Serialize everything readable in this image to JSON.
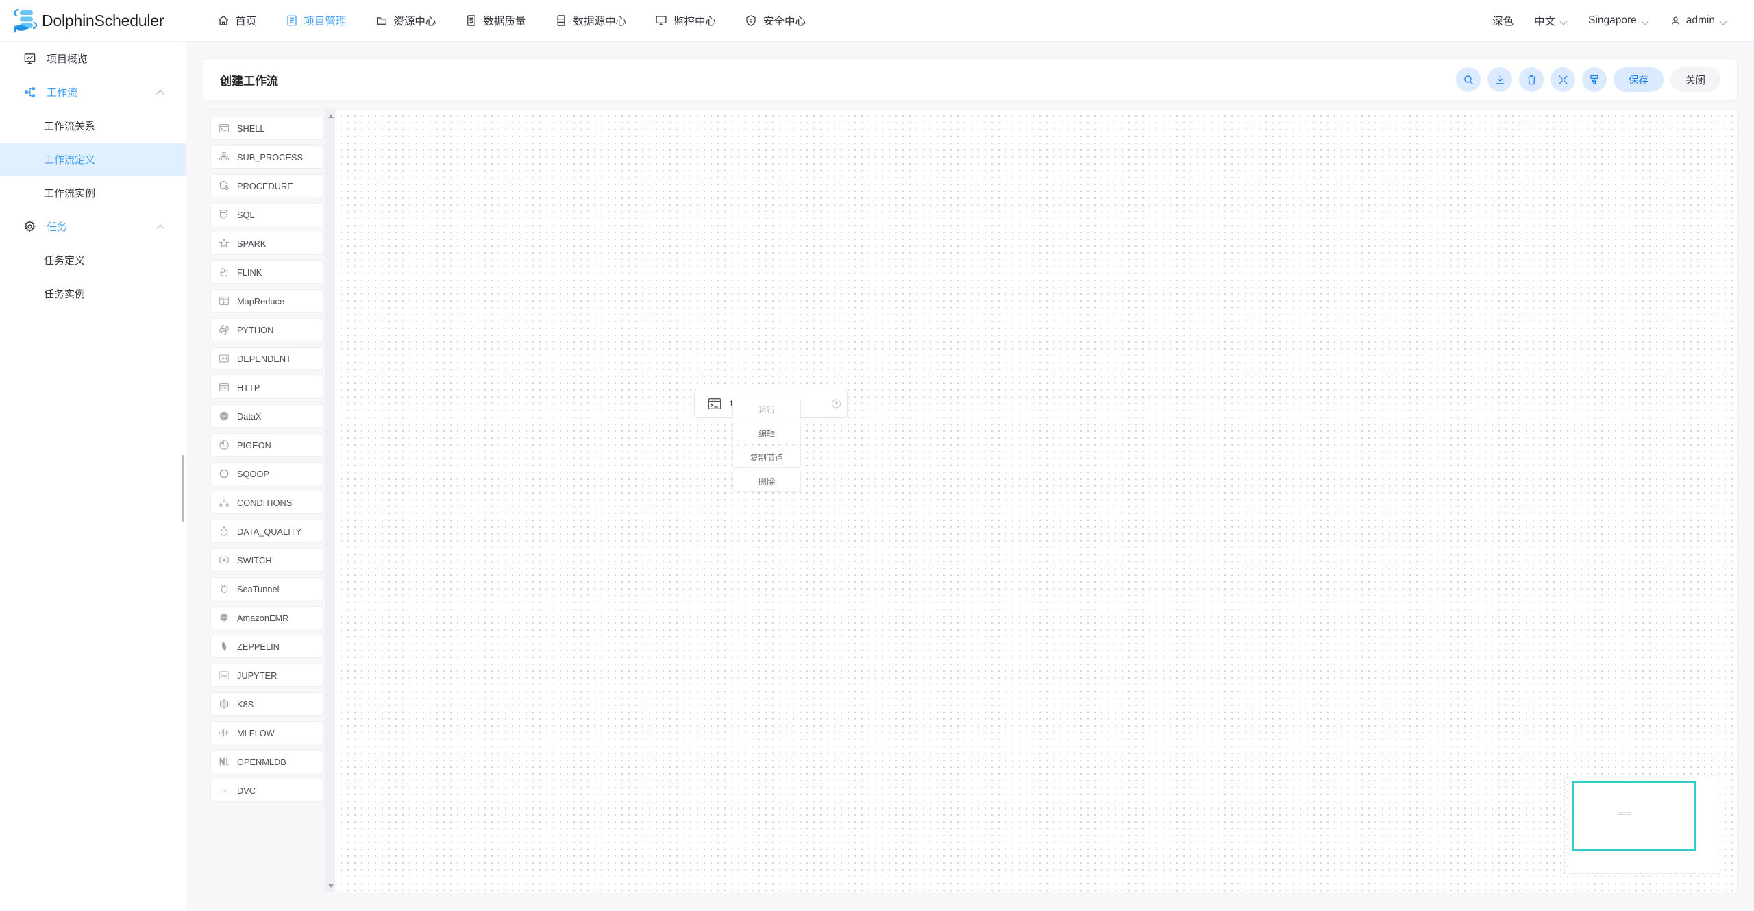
{
  "brand": {
    "name": "DolphinScheduler",
    "logo_icon": "dolphin-logo-icon"
  },
  "topnav": {
    "items": [
      {
        "label": "首页",
        "icon": "home-icon",
        "active": false
      },
      {
        "label": "项目管理",
        "icon": "project-icon",
        "active": true
      },
      {
        "label": "资源中心",
        "icon": "folder-icon",
        "active": false
      },
      {
        "label": "数据质量",
        "icon": "quality-icon",
        "active": false
      },
      {
        "label": "数据源中心",
        "icon": "datasource-icon",
        "active": false
      },
      {
        "label": "监控中心",
        "icon": "monitor-icon",
        "active": false
      },
      {
        "label": "安全中心",
        "icon": "shield-icon",
        "active": false
      }
    ],
    "right": {
      "theme": "深色",
      "language": "中文",
      "timezone": "Singapore",
      "user": "admin",
      "user_icon": "user-icon"
    }
  },
  "sidebar": {
    "items": [
      {
        "label": "项目概览",
        "icon": "overview-icon",
        "type": "link"
      },
      {
        "label": "工作流",
        "icon": "workflow-icon",
        "type": "group",
        "expanded": true
      },
      {
        "label": "工作流关系",
        "type": "sub"
      },
      {
        "label": "工作流定义",
        "type": "sub",
        "selected": true
      },
      {
        "label": "工作流实例",
        "type": "sub"
      },
      {
        "label": "任务",
        "icon": "gear-icon",
        "type": "group",
        "expanded": true
      },
      {
        "label": "任务定义",
        "type": "sub"
      },
      {
        "label": "任务实例",
        "type": "sub"
      }
    ]
  },
  "page": {
    "title": "创建工作流",
    "toolbar": {
      "icons": [
        {
          "name": "search-icon",
          "label": "搜索"
        },
        {
          "name": "download-icon",
          "label": "下载"
        },
        {
          "name": "delete-icon",
          "label": "删除"
        },
        {
          "name": "fullscreen-icon",
          "label": "全屏"
        },
        {
          "name": "format-icon",
          "label": "格式化"
        }
      ],
      "save_label": "保存",
      "close_label": "关闭"
    }
  },
  "palette": {
    "items": [
      {
        "label": "SHELL",
        "icon": "shell-icon"
      },
      {
        "label": "SUB_PROCESS",
        "icon": "subprocess-icon"
      },
      {
        "label": "PROCEDURE",
        "icon": "procedure-icon"
      },
      {
        "label": "SQL",
        "icon": "sql-icon"
      },
      {
        "label": "SPARK",
        "icon": "spark-icon"
      },
      {
        "label": "FLINK",
        "icon": "flink-icon"
      },
      {
        "label": "MapReduce",
        "icon": "mapreduce-icon"
      },
      {
        "label": "PYTHON",
        "icon": "python-icon"
      },
      {
        "label": "DEPENDENT",
        "icon": "dependent-icon"
      },
      {
        "label": "HTTP",
        "icon": "http-icon"
      },
      {
        "label": "DataX",
        "icon": "datax-icon"
      },
      {
        "label": "PIGEON",
        "icon": "pigeon-icon"
      },
      {
        "label": "SQOOP",
        "icon": "sqoop-icon"
      },
      {
        "label": "CONDITIONS",
        "icon": "conditions-icon"
      },
      {
        "label": "DATA_QUALITY",
        "icon": "dataquality-icon"
      },
      {
        "label": "SWITCH",
        "icon": "switch-icon"
      },
      {
        "label": "SeaTunnel",
        "icon": "seatunnel-icon"
      },
      {
        "label": "AmazonEMR",
        "icon": "amazonemr-icon"
      },
      {
        "label": "ZEPPELIN",
        "icon": "zeppelin-icon"
      },
      {
        "label": "JUPYTER",
        "icon": "jupyter-icon"
      },
      {
        "label": "K8S",
        "icon": "k8s-icon"
      },
      {
        "label": "MLFLOW",
        "icon": "mlflow-icon"
      },
      {
        "label": "OPENMLDB",
        "icon": "openmldb-icon"
      },
      {
        "label": "DVC",
        "icon": "dvc-icon"
      }
    ]
  },
  "canvas": {
    "node": {
      "label": "test",
      "icon": "shell-icon",
      "add_icon": "plus-icon"
    },
    "context_menu": {
      "items": [
        {
          "label": "运行",
          "disabled": true
        },
        {
          "label": "编辑",
          "disabled": false
        },
        {
          "label": "复制节点",
          "disabled": false
        },
        {
          "label": "删除",
          "disabled": false
        }
      ]
    },
    "minimap": {
      "viewport_color": "#33cccc"
    }
  },
  "colors": {
    "accent_blue": "#2080f0",
    "nav_active": "#3fa0f7",
    "sidebar_selected_bg": "#e1f0fe",
    "minimap_viewport": "#33cccc",
    "page_bg": "#f7f7fa"
  }
}
